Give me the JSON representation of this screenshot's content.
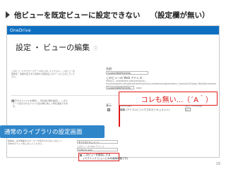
{
  "slide": {
    "title": "他ビューを既定ビューに設定できない",
    "subtitle": "（設定欄が無い）",
    "page_number": "19"
  },
  "screenshot": {
    "brand": "OneDrive",
    "page_title": "設定 ・ ビューの編集",
    "name_label": "名前:",
    "name_value": "CustomWebPartView",
    "address_label": "このビューの Web アドレス:",
    "address_url_1": "https://...sharepoint.com/personal/...",
    "address_url_2": "my.sharepoint.com/personal/hikaruhisa_aslesamsungelectronic/_layouts/15/wopi_files/Documents/Forms/",
    "address_value": "CustomWebPartView",
    "aspx": ".aspx",
    "description_1": "このビューにサブワークテーマを入力してください。このビューの名前を、名前を変えずに利用する場合はこのページに入力してください。",
    "description_2": "表示するファイルを選択し、列の並び順を設定し、このビューで表示されるファイル名の横に新しい列を追加できます。",
    "columns_header": "列",
    "show_header": "表示",
    "column_name_header": "列の名前",
    "order_header": "左からの位置",
    "rows": [
      {
        "name": "種類 (アイコンにリンクされたドキュメント)",
        "order": "1"
      }
    ]
  },
  "callouts": {
    "red_text": "コレも無い...（´A｀）",
    "blue_label": "通常のライブラリの設定画面"
  },
  "lower": {
    "description": "名前は、必ず関連するマーカーが表示されるかこのビューのWebアドレスを入力してください。",
    "input_value": "すべてのドキュメント",
    "hint": "このビューの Web アドレス",
    "input2_value": "AllItems.aspx",
    "checkbox_line1": "このビューを既定にする",
    "checkbox_line2": "(パブリック ビューにのみ適用可能です)"
  },
  "colors": {
    "topbar": "#0e6fc1",
    "highlight_red": "#e01818",
    "callout_blue": "#2f86c9"
  }
}
